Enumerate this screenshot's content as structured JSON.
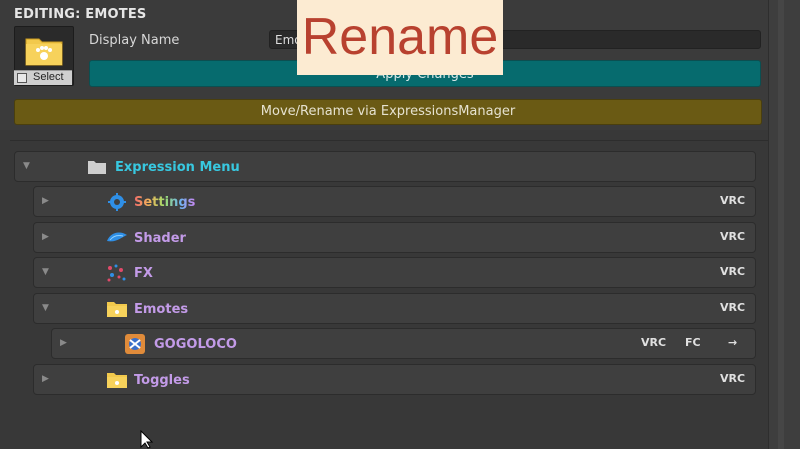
{
  "editor": {
    "title": "EDITING: EMOTES",
    "select_label": "Select",
    "display_name_label": "Display Name",
    "display_name_value": "Emo",
    "apply_label": "Apply Changes",
    "move_rename_label": "Move/Rename via ExpressionsManager"
  },
  "overlay": {
    "text": "Rename"
  },
  "tree": {
    "root": {
      "label": "Expression Menu",
      "color": "#38c8e0"
    },
    "items": [
      {
        "label": "Settings",
        "tag": "VRC",
        "icon": "gear-icon",
        "color": "#e07070"
      },
      {
        "label": "Shader",
        "tag": "VRC",
        "icon": "shader-icon",
        "color": "#c39be8"
      },
      {
        "label": "FX",
        "tag": "VRC",
        "icon": "particles-icon",
        "color": "#c39be8"
      },
      {
        "label": "Emotes",
        "tag": "VRC",
        "icon": "folder-icon",
        "color": "#c39be8"
      },
      {
        "label": "GOGOLOCO",
        "tags": [
          "VRC",
          "FC"
        ],
        "arrow": "→",
        "icon": "gogoloco-icon",
        "color": "#c39be8"
      },
      {
        "label": "Toggles",
        "tag": "VRC",
        "icon": "folder-icon",
        "color": "#c39be8"
      }
    ]
  },
  "colors": {
    "apply": "#066b6e",
    "move": "#6a5a14",
    "overlay_bg": "#fcebd2",
    "overlay_text": "#b8412f"
  }
}
